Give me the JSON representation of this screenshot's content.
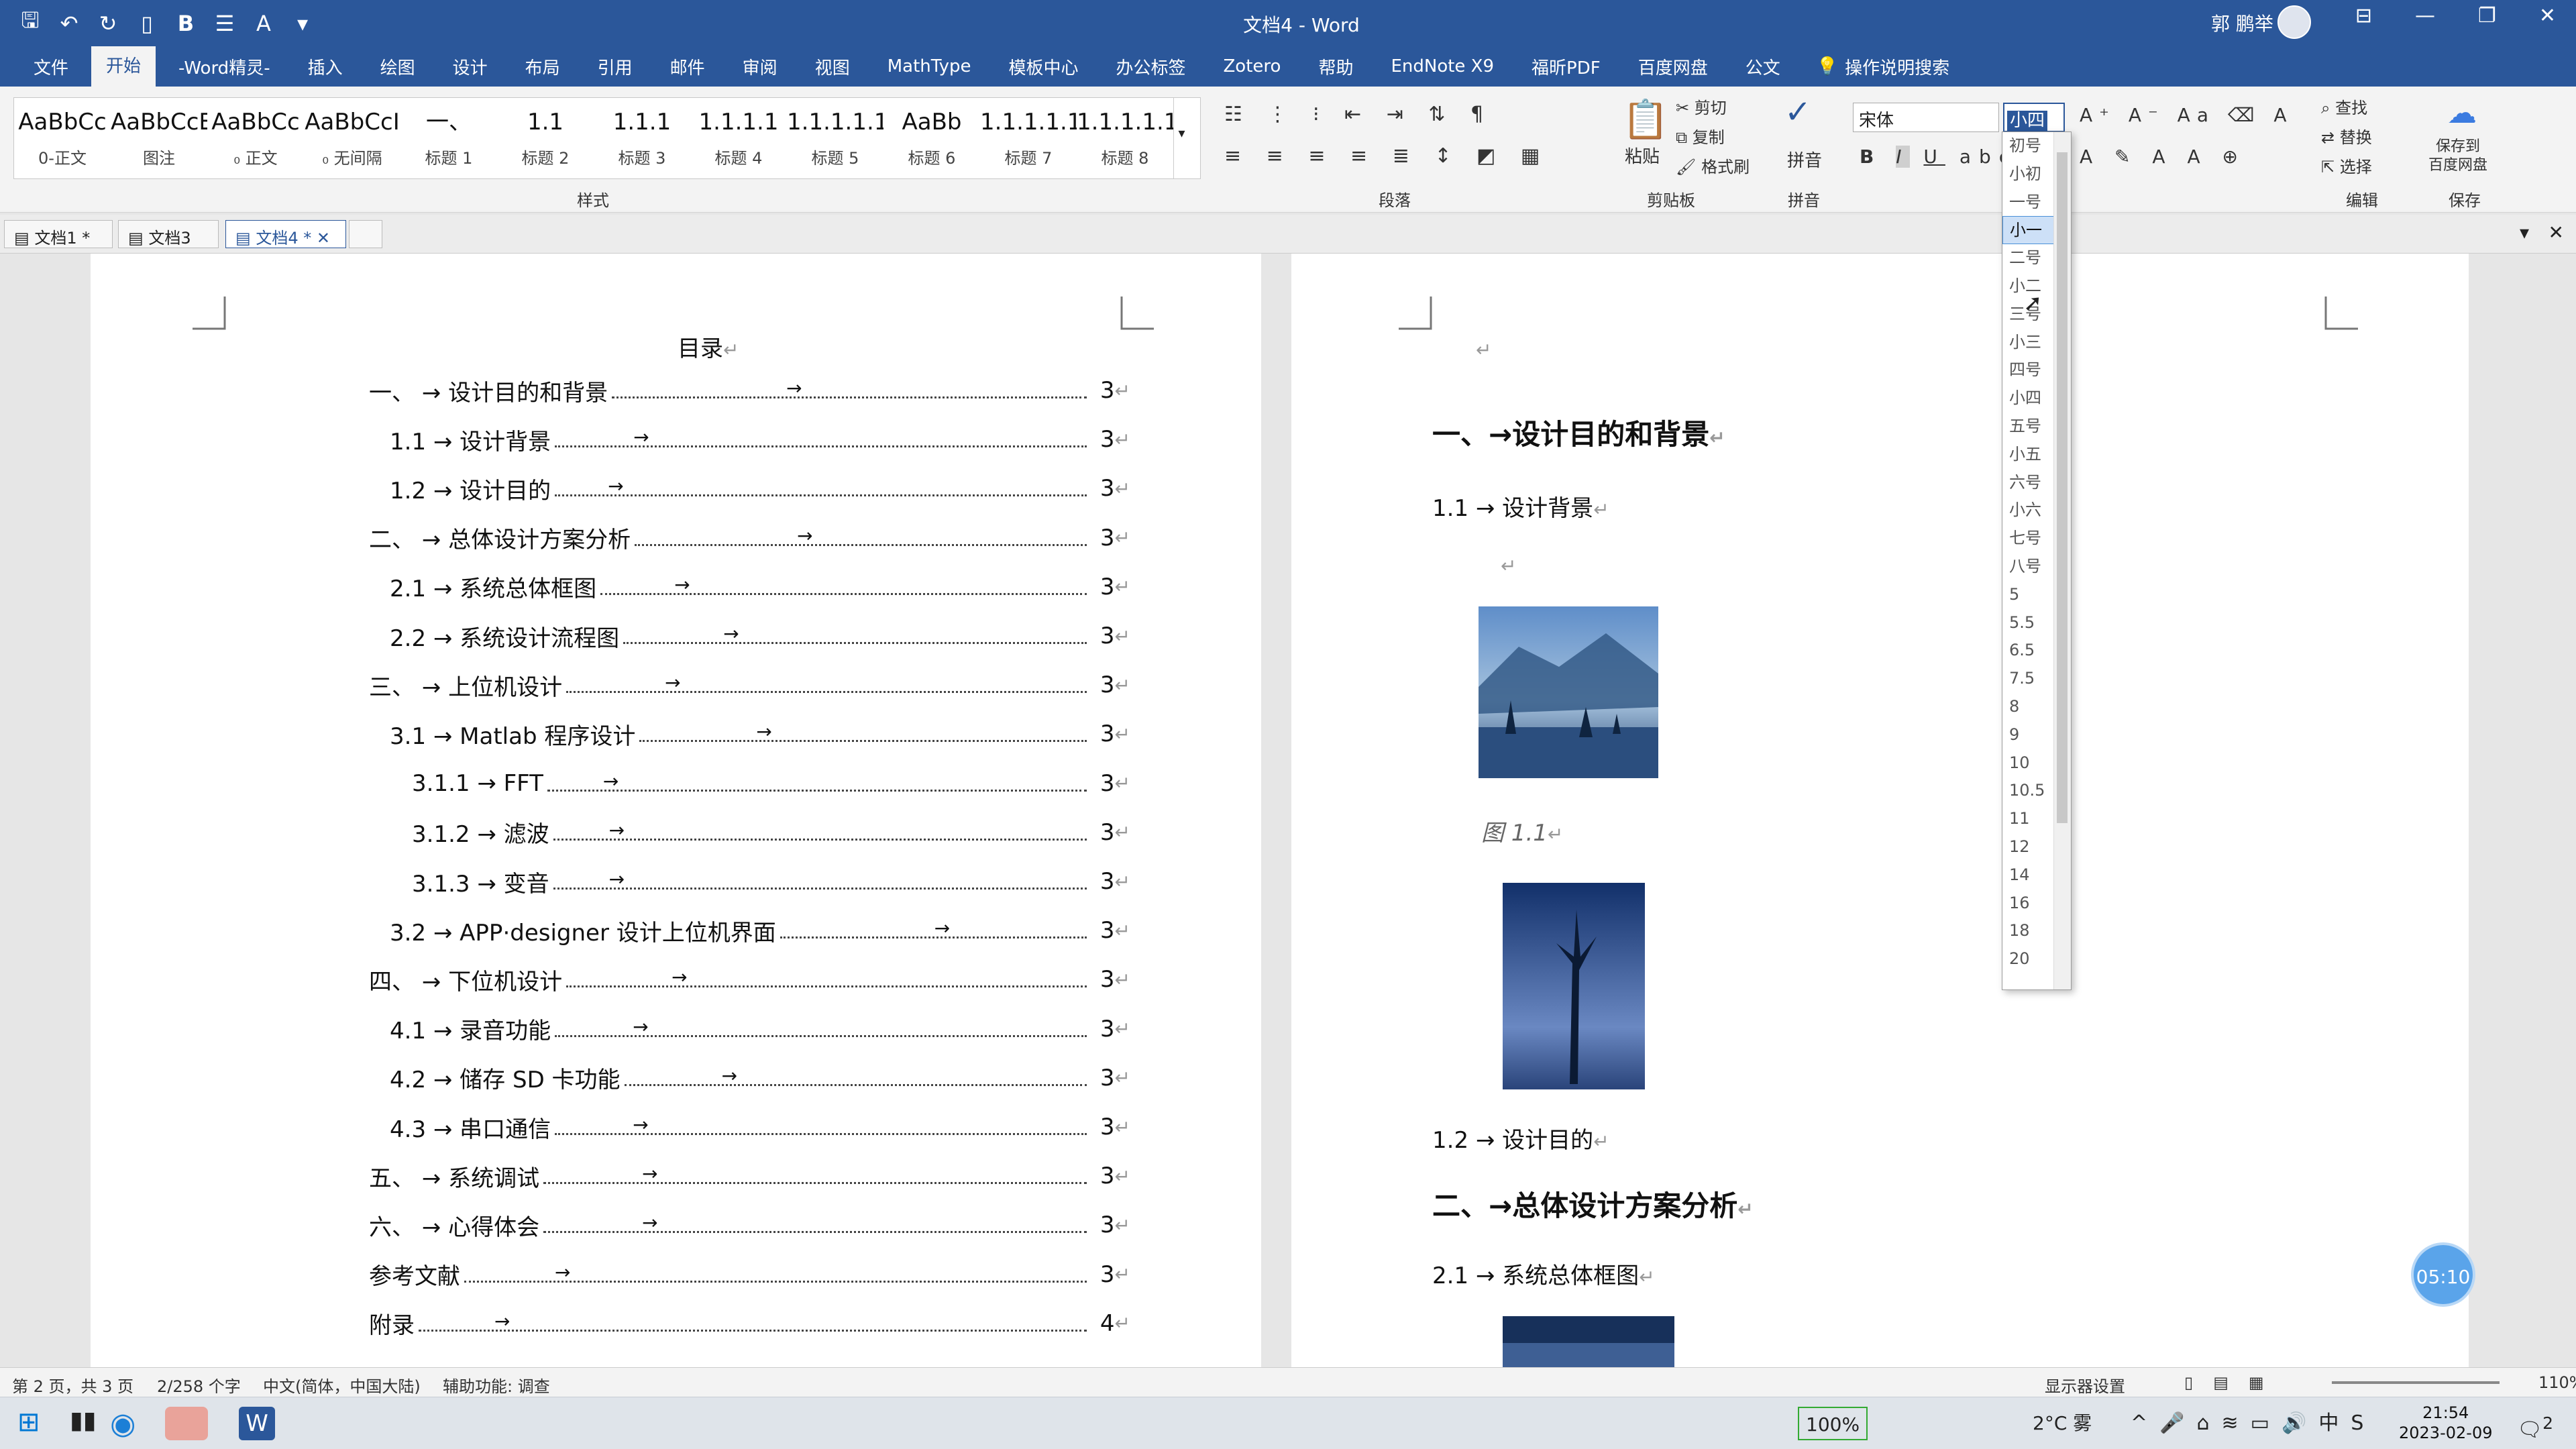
{
  "window": {
    "doc_title": "文档4 - Word",
    "user_name": "郭 鹏举"
  },
  "quick_access": [
    "save-icon",
    "undo-icon",
    "redo-icon",
    "new-doc-icon",
    "bold-icon",
    "list-icon",
    "style-icon",
    "more-icon"
  ],
  "tabs": [
    "文件",
    "开始",
    "-Word精灵-",
    "插入",
    "绘图",
    "设计",
    "布局",
    "引用",
    "邮件",
    "审阅",
    "视图",
    "MathType",
    "模板中心",
    "办公标签",
    "Zotero",
    "帮助",
    "EndNote X9",
    "福昕PDF",
    "百度网盘",
    "公文"
  ],
  "active_tab": "开始",
  "tell_me": "操作说明搜索",
  "styles": [
    {
      "preview": "AaBbCc",
      "label": "0-正文"
    },
    {
      "preview": "AaBbCcE",
      "label": "图注"
    },
    {
      "preview": "AaBbCc",
      "label": "₀ 正文"
    },
    {
      "preview": "AaBbCcI",
      "label": "₀ 无间隔"
    },
    {
      "preview": "一、",
      "label": "标题 1"
    },
    {
      "preview": "1.1",
      "label": "标题 2"
    },
    {
      "preview": "1.1.1",
      "label": "标题 3"
    },
    {
      "preview": "1.1.1.1",
      "label": "标题 4"
    },
    {
      "preview": "1.1.1.1.1",
      "label": "标题 5"
    },
    {
      "preview": "AaBb",
      "label": "标题 6"
    },
    {
      "preview": "1.1.1.1.1",
      "label": "标题 7"
    },
    {
      "preview": "1.1.1.1.1",
      "label": "标题 8"
    }
  ],
  "group_labels": {
    "styles": "样式",
    "paragraph": "段落",
    "clipboard": "剪贴板",
    "pinyin": "拼音",
    "edit": "编辑",
    "save": "保存"
  },
  "clipboard": {
    "paste": "粘贴",
    "cut": "剪切",
    "copy": "复制",
    "format_painter": "格式刷"
  },
  "pinyin_label": "拼音",
  "font": {
    "name": "宋体",
    "size": "小四"
  },
  "edit": {
    "find": "查找",
    "replace": "替换",
    "select": "选择"
  },
  "save_baidu": [
    "保存到",
    "百度网盘"
  ],
  "doc_tabs": [
    "文档1 *",
    "文档3",
    "文档4 *"
  ],
  "size_options": [
    "初号",
    "小初",
    "一号",
    "小一",
    "二号",
    "小二",
    "三号",
    "小三",
    "四号",
    "小四",
    "五号",
    "小五",
    "六号",
    "小六",
    "七号",
    "八号",
    "5",
    "5.5",
    "6.5",
    "7.5",
    "8",
    "9",
    "10",
    "10.5",
    "11",
    "12",
    "14",
    "16",
    "18",
    "20"
  ],
  "size_selected": "小一",
  "toc": {
    "title": "目录",
    "entries": [
      {
        "text": "一、 → 设计目的和背景",
        "page": "3",
        "indent": 0
      },
      {
        "text": "1.1 → 设计背景",
        "page": "3",
        "indent": 1
      },
      {
        "text": "1.2 → 设计目的",
        "page": "3",
        "indent": 1
      },
      {
        "text": "二、 → 总体设计方案分析",
        "page": "3",
        "indent": 0
      },
      {
        "text": "2.1 → 系统总体框图",
        "page": "3",
        "indent": 1
      },
      {
        "text": "2.2 → 系统设计流程图",
        "page": "3",
        "indent": 1
      },
      {
        "text": "三、 → 上位机设计",
        "page": "3",
        "indent": 0
      },
      {
        "text": "3.1 → Matlab 程序设计",
        "page": "3",
        "indent": 1
      },
      {
        "text": "3.1.1 → FFT",
        "page": "3",
        "indent": 2
      },
      {
        "text": "3.1.2 → 滤波",
        "page": "3",
        "indent": 2
      },
      {
        "text": "3.1.3 → 变音",
        "page": "3",
        "indent": 2
      },
      {
        "text": "3.2 → APP·designer 设计上位机界面",
        "page": "3",
        "indent": 1
      },
      {
        "text": "四、 → 下位机设计",
        "page": "3",
        "indent": 0
      },
      {
        "text": "4.1 → 录音功能",
        "page": "3",
        "indent": 1
      },
      {
        "text": "4.2 → 储存 SD 卡功能",
        "page": "3",
        "indent": 1
      },
      {
        "text": "4.3 → 串口通信",
        "page": "3",
        "indent": 1
      },
      {
        "text": "五、 → 系统调试",
        "page": "3",
        "indent": 0
      },
      {
        "text": "六、 → 心得体会",
        "page": "3",
        "indent": 0
      },
      {
        "text": "参考文献",
        "page": "3",
        "indent": 0
      },
      {
        "text": "附录",
        "page": "4",
        "indent": 0
      }
    ]
  },
  "right_page": {
    "h1_a": "一、→设计目的和背景",
    "h2_a": "1.1 → 设计背景",
    "caption": "图 1.1",
    "h2_b": "1.2 → 设计目的",
    "h1_b": "二、→总体设计方案分析",
    "h2_c": "2.1 → 系统总体框图"
  },
  "timer": "05:10",
  "status": {
    "page": "第 2 页，共 3 页",
    "words": "2/258 个字",
    "lang": "中文(简体，中国大陆)",
    "access": "辅助功能: 调查",
    "display": "显示器设置",
    "zoom": "110%"
  },
  "taskbar": {
    "battery": "100%",
    "weather": "2°C 雾",
    "time": "21:54",
    "date": "2023-02-09",
    "notif": "2"
  },
  "colors": {
    "brand": "#2b579a",
    "timer": "#5aa4ea"
  }
}
